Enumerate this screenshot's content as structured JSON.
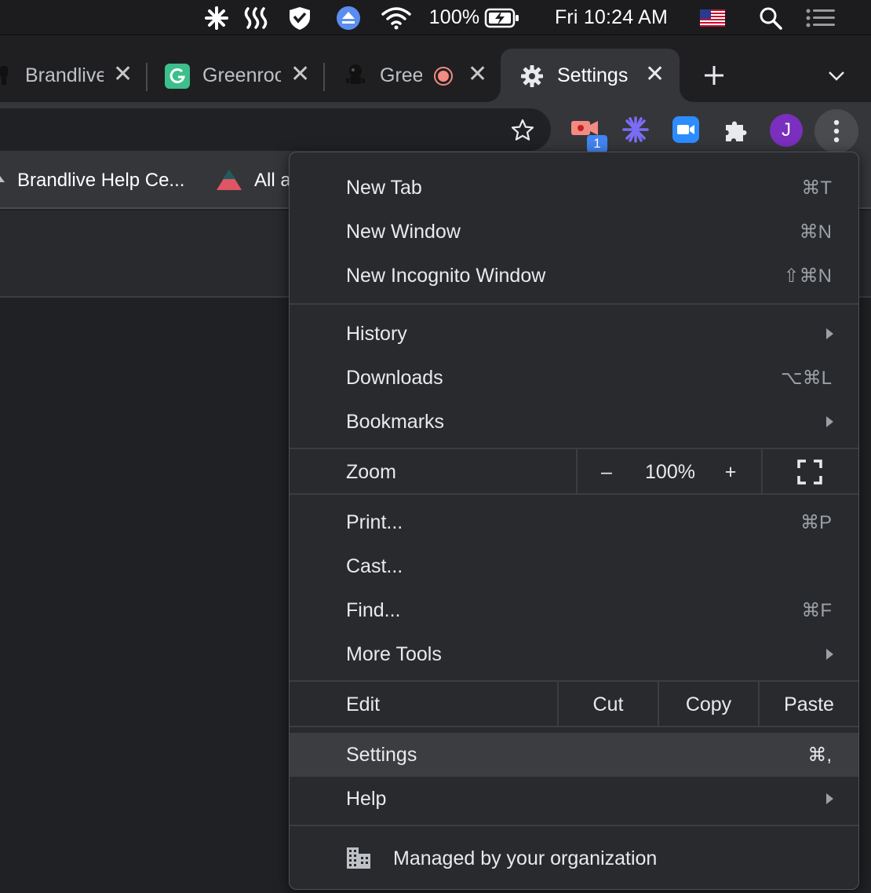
{
  "menubar": {
    "battery_percent": "100%",
    "clock": "Fri 10:24 AM",
    "icons": [
      "pinwheel-icon",
      "heat-waves-icon",
      "shield-icon",
      "eject-icon",
      "wifi-icon",
      "battery-charging-icon",
      "us-flag-icon",
      "spotlight-search-icon",
      "control-center-icon"
    ]
  },
  "tabs": [
    {
      "title": "Brandlive",
      "icon": "robot-icon"
    },
    {
      "title": "Greenroom",
      "icon": "greenroom-logo-icon"
    },
    {
      "title": "Gree",
      "icon": "robot-icon",
      "recording": true
    },
    {
      "title": "Settings",
      "icon": "gear-icon",
      "active": true
    }
  ],
  "toolbar": {
    "extension_badge": "1",
    "profile_initial": "J",
    "icons": [
      "bookmark-star-icon",
      "video-record-extension-icon",
      "asterisk-extension-icon",
      "zoom-extension-icon",
      "extensions-puzzle-icon",
      "more-vert-icon"
    ]
  },
  "bookmarks": {
    "items": [
      {
        "label": "Brandlive Help Ce..."
      },
      {
        "label": "All a"
      }
    ]
  },
  "menu": {
    "items": [
      {
        "label": "New Tab",
        "shortcut": "⌘T"
      },
      {
        "label": "New Window",
        "shortcut": "⌘N"
      },
      {
        "label": "New Incognito Window",
        "shortcut": "⇧⌘N"
      },
      {
        "label": "History",
        "submenu": true
      },
      {
        "label": "Downloads",
        "shortcut": "⌥⌘L"
      },
      {
        "label": "Bookmarks",
        "submenu": true
      },
      {
        "label": "Print...",
        "shortcut": "⌘P"
      },
      {
        "label": "Cast..."
      },
      {
        "label": "Find...",
        "shortcut": "⌘F"
      },
      {
        "label": "More Tools",
        "submenu": true
      },
      {
        "label": "Settings",
        "shortcut": "⌘,",
        "highlighted": true
      },
      {
        "label": "Help",
        "submenu": true
      }
    ],
    "zoom": {
      "label": "Zoom",
      "minus": "–",
      "value": "100%",
      "plus": "+"
    },
    "edit": {
      "label": "Edit",
      "cut": "Cut",
      "copy": "Copy",
      "paste": "Paste"
    },
    "managed": "Managed by your organization"
  }
}
